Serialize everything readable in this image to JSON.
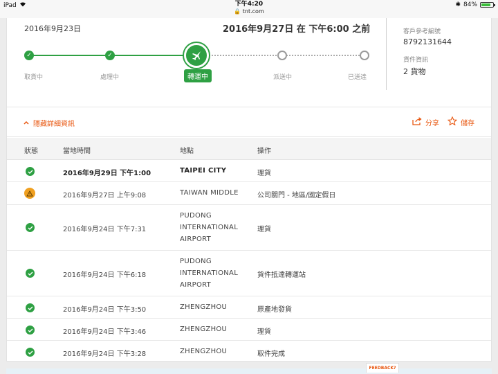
{
  "status_bar": {
    "device": "iPad",
    "time": "下午4:20",
    "url": "tnt.com",
    "battery": "84%",
    "battery_level": 0.84
  },
  "shipment": {
    "start_date": "2016年9月23日",
    "eta_prefix": "2016年9月27日 在 下午6:00 之前",
    "ref_label": "客戶參考編號",
    "ref_value": "8792131644",
    "cargo_label": "貨件資訊",
    "cargo_value": "2 貨物"
  },
  "tracker": {
    "steps": [
      {
        "label": "取貨中",
        "state": "done"
      },
      {
        "label": "處理中",
        "state": "done"
      },
      {
        "label": "轉運中",
        "state": "current"
      },
      {
        "label": "派送中",
        "state": "pending"
      },
      {
        "label": "已送達",
        "state": "pending"
      }
    ]
  },
  "actions": {
    "toggle_label": "隱藏詳細資訊",
    "share_label": "分享",
    "save_label": "儲存"
  },
  "table": {
    "headers": [
      "狀態",
      "當地時間",
      "地點",
      "操作"
    ],
    "rows": [
      {
        "status": "ok",
        "time": "2016年9月29日 下午1:00",
        "location": "TAIPEI CITY",
        "action": "理貨"
      },
      {
        "status": "warning",
        "time": "2016年9月27日 上午9:08",
        "location": "TAIWAN MIDDLE",
        "action": "公司關門 - 地區/國定假日"
      },
      {
        "status": "ok",
        "time": "2016年9月24日 下午7:31",
        "location": "PUDONG INTERNATIONAL AIRPORT",
        "action": "理貨"
      },
      {
        "status": "ok",
        "time": "2016年9月24日 下午6:18",
        "location": "PUDONG INTERNATIONAL AIRPORT",
        "action": "貨件抵達轉運站"
      },
      {
        "status": "ok",
        "time": "2016年9月24日 下午3:50",
        "location": "ZHENGZHOU",
        "action": "原產地發貨"
      },
      {
        "status": "ok",
        "time": "2016年9月24日 下午3:46",
        "location": "ZHENGZHOU",
        "action": "理貨"
      },
      {
        "status": "ok",
        "time": "2016年9月24日 下午3:28",
        "location": "ZHENGZHOU",
        "action": "取件完成"
      }
    ]
  },
  "feedback_label": "FEEDBACK?",
  "colors": {
    "green": "#2ea043",
    "orange": "#e8560f",
    "warning": "#f0a020"
  }
}
